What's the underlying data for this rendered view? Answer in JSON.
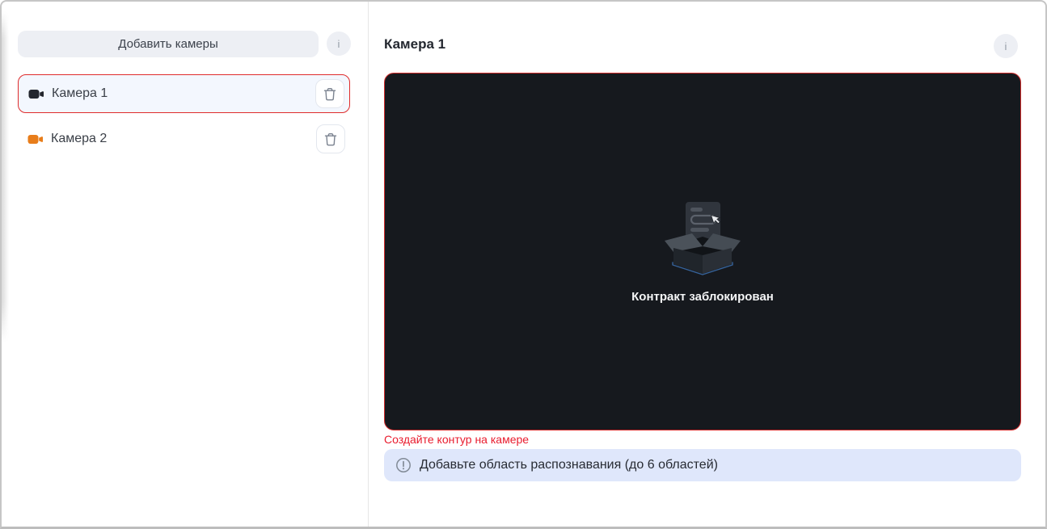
{
  "colors": {
    "selection_red": "#df2b2b",
    "video_border_red": "#d22b2b",
    "error_red": "#e91c2e",
    "alert_bg": "#dfe7fb",
    "video_bg": "#16191e",
    "camera1_icon_color": "#23262d",
    "camera2_icon_color": "#e87d1a"
  },
  "sidebar": {
    "add_button_label": "Добавить камеры",
    "info_label": "i",
    "cameras": [
      {
        "name": "Камера 1",
        "icon_color": "#23262d",
        "selected": true
      },
      {
        "name": "Камера 2",
        "icon_color": "#e87d1a",
        "selected": false
      }
    ]
  },
  "main": {
    "title": "Камера 1",
    "info_label": "i",
    "video_placeholder": {
      "text": "Контракт заблокирован"
    },
    "error_text": "Создайте контур на камере",
    "alert_text": "Добавьте область распознавания (до 6 областей)"
  }
}
